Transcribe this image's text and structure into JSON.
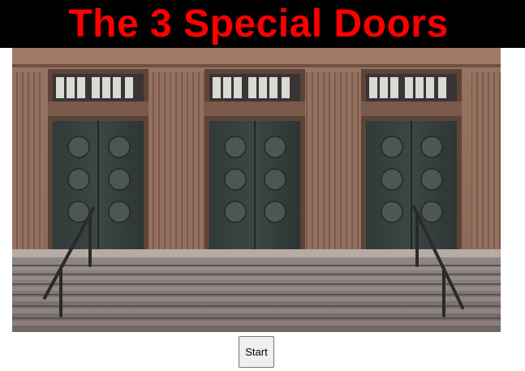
{
  "header": {
    "title": "The 3 Special Doors",
    "title_color": "#ff0000",
    "background_color": "#000000"
  },
  "scene": {
    "image": "three-doors-photo",
    "door_count": 3
  },
  "controls": {
    "start_label": "Start"
  }
}
